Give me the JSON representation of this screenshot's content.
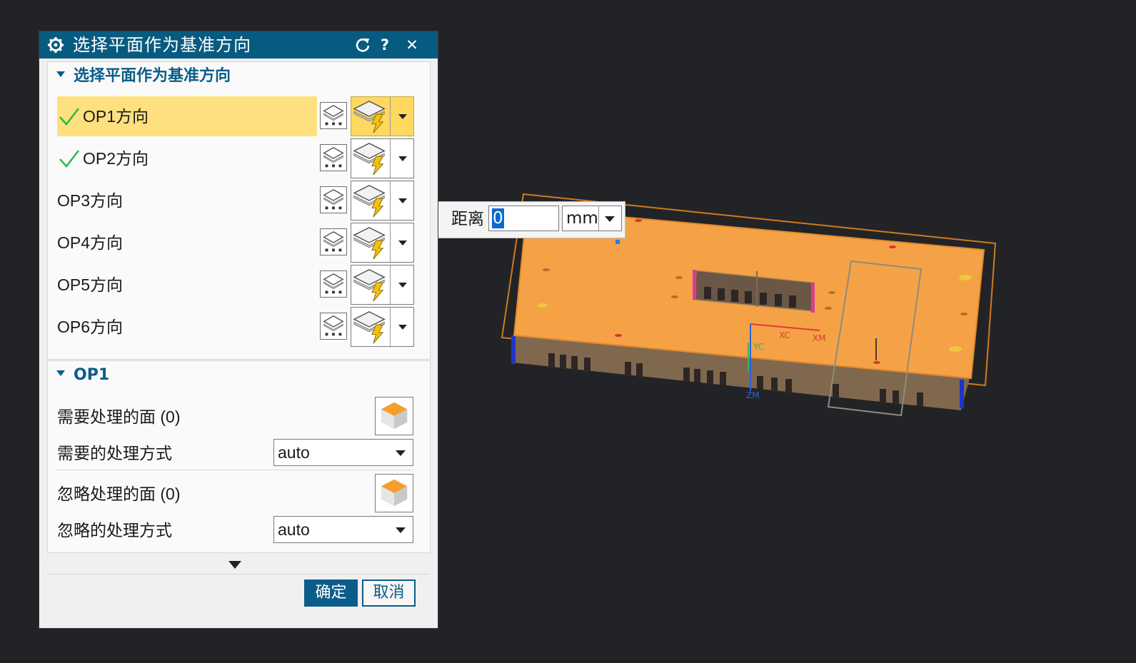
{
  "dialog": {
    "title": "选择平面作为基准方向",
    "refresh_icon": "refresh-icon",
    "help_label": "?",
    "close_label": "✕",
    "ok_label": "确定",
    "cancel_label": "取消"
  },
  "plane_group": {
    "header": "选择平面作为基准方向",
    "rows": [
      {
        "label": "OP1方向",
        "checked": true,
        "selected": true
      },
      {
        "label": "OP2方向",
        "checked": true,
        "selected": false
      },
      {
        "label": "OP3方向",
        "checked": false,
        "selected": false
      },
      {
        "label": "OP4方向",
        "checked": false,
        "selected": false
      },
      {
        "label": "OP5方向",
        "checked": false,
        "selected": false
      },
      {
        "label": "OP6方向",
        "checked": false,
        "selected": false
      }
    ]
  },
  "op_group": {
    "header": "OP1",
    "faces_to_process_label": "需要处理的面 (0)",
    "process_method_label": "需要的处理方式",
    "process_method_value": "auto",
    "faces_to_ignore_label": "忽略处理的面 (0)",
    "ignore_method_label": "忽略的处理方式",
    "ignore_method_value": "auto"
  },
  "distance_popup": {
    "label": "距离",
    "value": "0",
    "unit": "mm"
  },
  "viewport": {
    "axis_labels": [
      "XC",
      "XM",
      "YC",
      "ZM"
    ]
  },
  "colors": {
    "title_bar": "#085b80",
    "accent": "#0a5d88",
    "selected_row": "#ffe07e",
    "plate_top": "#f5a246",
    "plate_side": "#80684f",
    "background": "#222326"
  }
}
